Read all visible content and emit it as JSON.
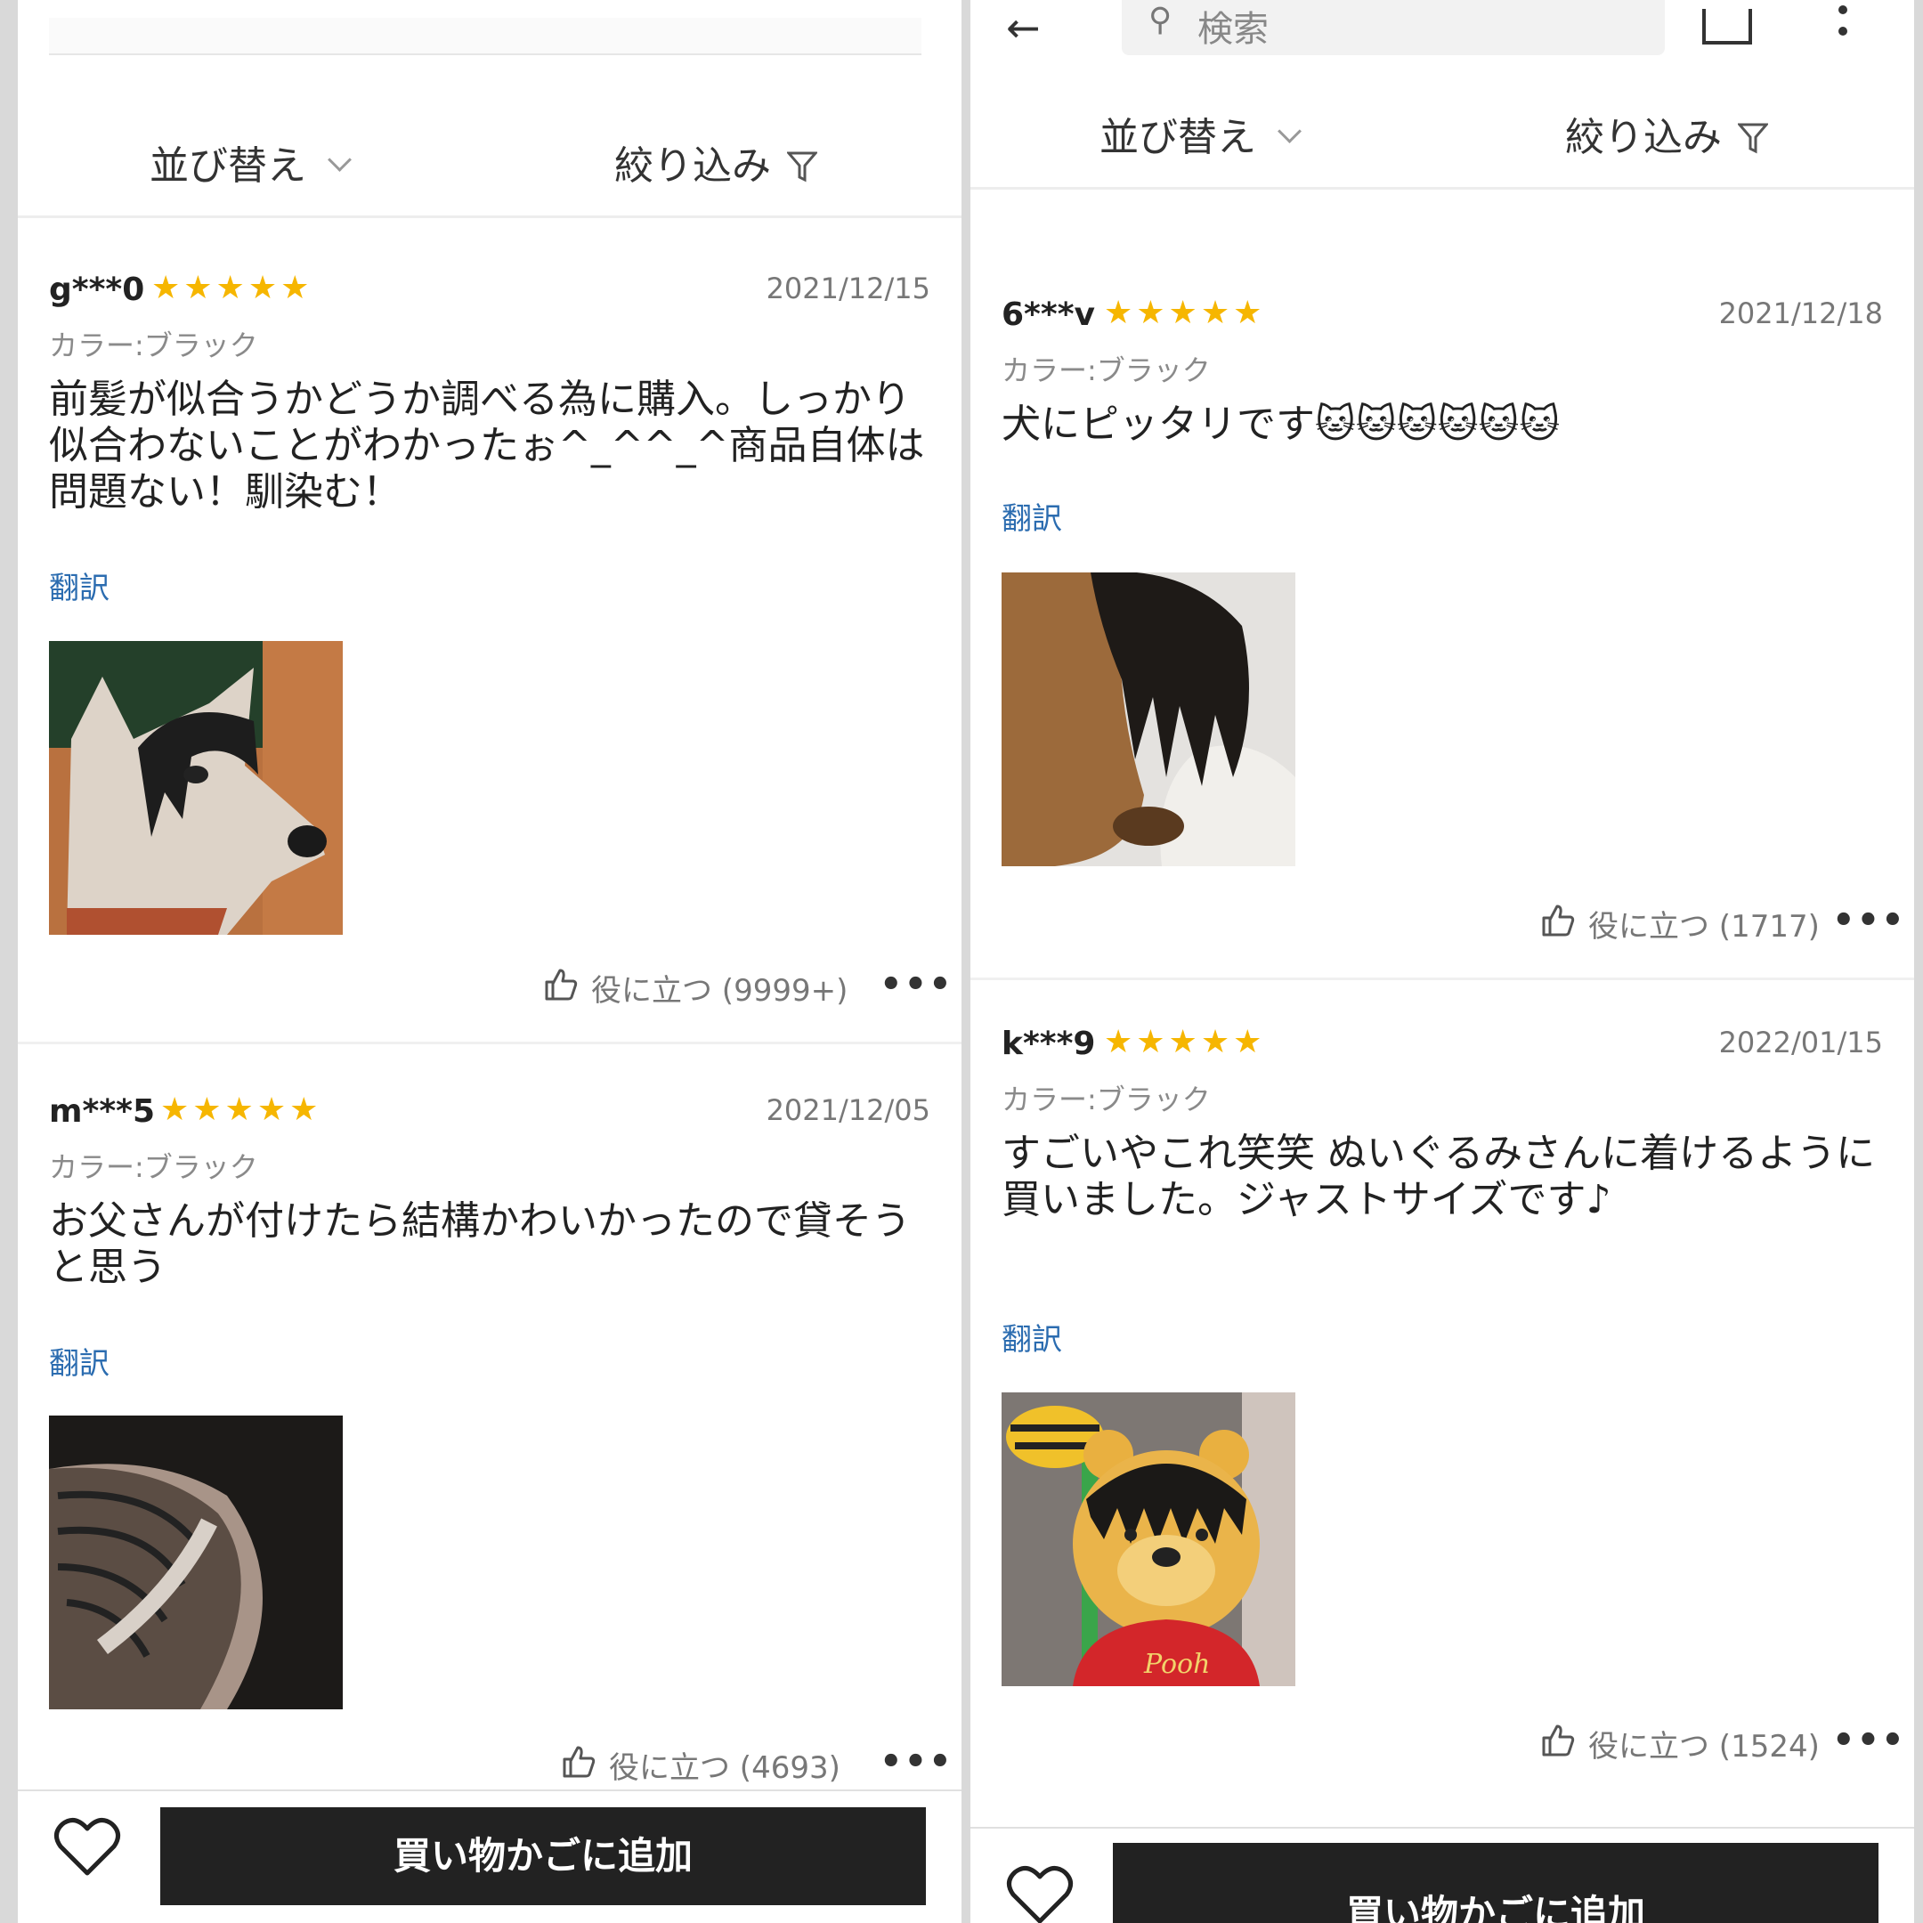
{
  "left": {
    "sort_label": "並び替え",
    "filter_label": "絞り込み",
    "reviews": [
      {
        "user": "g***0",
        "stars": "★★★★★",
        "date": "2021/12/15",
        "color": "カラー:ブラック",
        "text": "前髪が似合うかどうか調べる為に購入。しっかり似合わないことがわかったぉ^_^^_^商品自体は問題ない！馴染む！",
        "translate": "翻訳",
        "helpful": "役に立つ (9999+)"
      },
      {
        "user": "m***5",
        "stars": "★★★★★",
        "date": "2021/12/05",
        "color": "カラー:ブラック",
        "text": "お父さんが付けたら結構かわいかったので貸そうと思う",
        "translate": "翻訳",
        "helpful": "役に立つ (4693)"
      }
    ],
    "more_label": "•••",
    "cart_button": "買い物かごに追加"
  },
  "right": {
    "search_placeholder": "検索",
    "sort_label": "並び替え",
    "filter_label": "絞り込み",
    "reviews": [
      {
        "user": "6***v",
        "stars": "★★★★★",
        "date": "2021/12/18",
        "color": "カラー:ブラック",
        "text": "犬にピッタリです🐱🐱🐱🐱🐱🐱",
        "translate": "翻訳",
        "helpful": "役に立つ (1717)"
      },
      {
        "user": "k***9",
        "stars": "★★★★★",
        "date": "2022/01/15",
        "color": "カラー:ブラック",
        "text": "すごいやこれ笑笑 ぬいぐるみさんに着けるように\n買いました。ジャストサイズです♪",
        "translate": "翻訳",
        "helpful": "役に立つ (1524)"
      }
    ],
    "more_label": "•••",
    "cart_button": "買い物かごに追加"
  },
  "colors": {
    "star": "#f6b600",
    "link": "#2b6cb0",
    "button": "#222222"
  },
  "photo_labels": {
    "pooh_shirt": "Pooh"
  }
}
